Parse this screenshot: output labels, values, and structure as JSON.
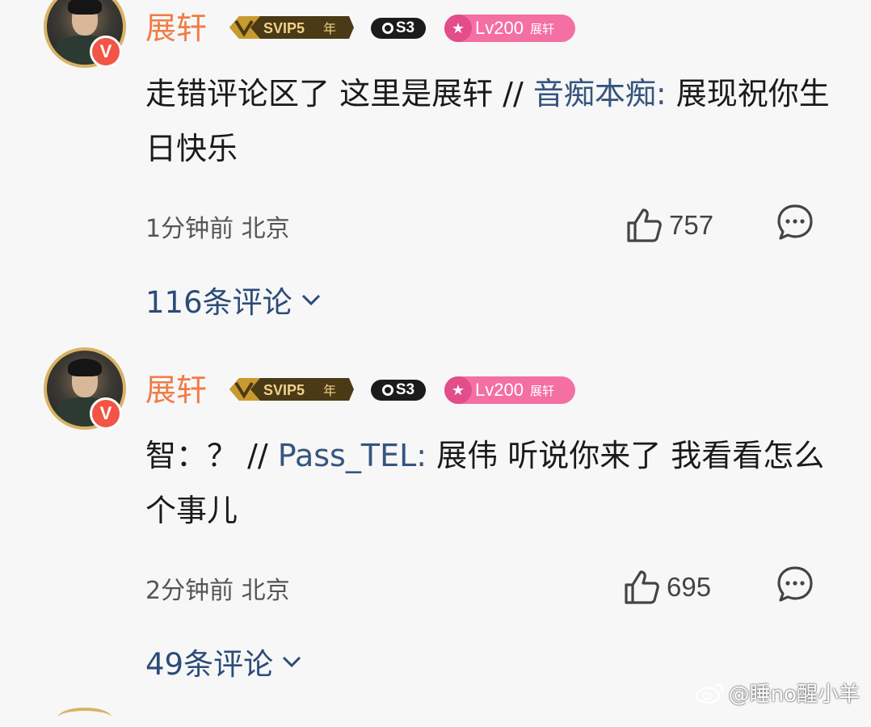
{
  "comments": [
    {
      "username": "展轩",
      "vip_badge": "SVIP5",
      "vip_suffix": "年",
      "s3_badge": "S3",
      "level_badge": "Lv200",
      "level_name": "展轩",
      "text_main": "走错评论区了 这里是展轩 // ",
      "mention": "音痴本痴:",
      "text_rest": " 展现祝你生日快乐",
      "time_location": "1分钟前 北京",
      "likes": "757",
      "replies_label": "116条评论"
    },
    {
      "username": "展轩",
      "vip_badge": "SVIP5",
      "vip_suffix": "年",
      "s3_badge": "S3",
      "level_badge": "Lv200",
      "level_name": "展轩",
      "text_main": "智：？  // ",
      "mention": "Pass_TEL:",
      "text_rest": " 展伟 听说你来了 我看看怎么个事儿",
      "time_location": "2分钟前 北京",
      "likes": "695",
      "replies_label": "49条评论"
    }
  ],
  "watermark": "@睡no醒小羊",
  "icons": {
    "verified": "V",
    "like": "thumbs-up-icon",
    "reply": "comment-bubble-icon",
    "expand": "chevron-down-icon",
    "watermark_logo": "weibo-logo-icon"
  },
  "colors": {
    "username": "#f07c45",
    "mention": "#36557f",
    "replies": "#2c4b78",
    "verified": "#f25545",
    "level_badge": "#f46fa3",
    "svip_gold": "#c99a2e"
  }
}
